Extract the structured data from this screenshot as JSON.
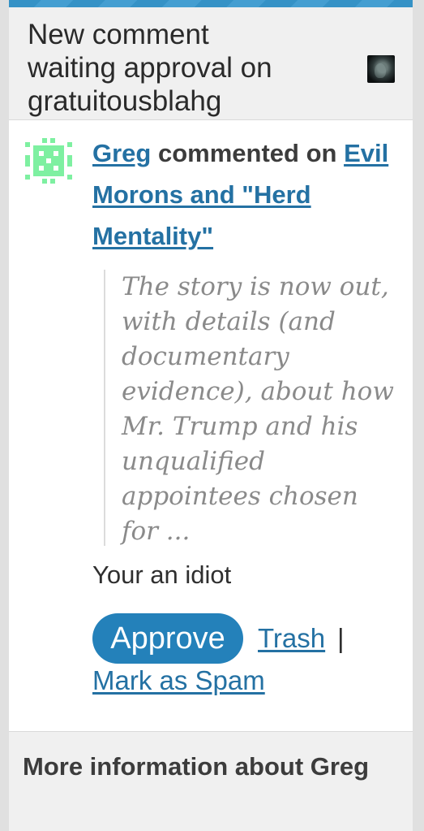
{
  "header": {
    "title_lines": "New comment\nwaiting approval on\ngratuitousblahg",
    "site_icon": "site-avatar-icon"
  },
  "comment": {
    "author": "Greg",
    "commented_on_text": " commented on ",
    "post_title": "Evil Morons and \"Herd Mentality\"",
    "avatar_icon": "identicon-avatar",
    "avatar_color": "#7ef0a1",
    "excerpt": "The story is now out, with details (and documentary evidence), about how Mr. Trump and his unqualified appointees chosen for ...",
    "text": "Your an idiot"
  },
  "actions": {
    "approve_label": "Approve",
    "trash_label": "Trash",
    "separator": "|",
    "spam_label": "Mark as Spam"
  },
  "more_info": {
    "title": "More information about Greg"
  },
  "colors": {
    "accent": "#2481ba",
    "link": "#2471a3",
    "header_bg": "#f0f0f0"
  }
}
